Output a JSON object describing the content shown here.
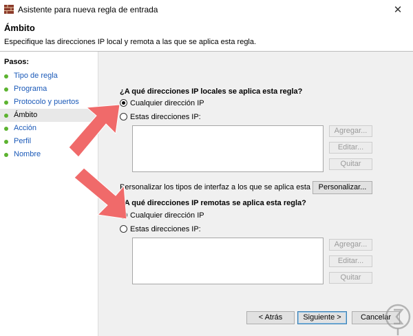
{
  "window": {
    "title": "Asistente para nueva regla de entrada",
    "close_icon": "close-icon"
  },
  "header": {
    "title": "Ámbito",
    "description": "Especifique las direcciones IP local y remota a las que se aplica esta regla."
  },
  "sidebar": {
    "steps_label": "Pasos:",
    "items": [
      {
        "label": "Tipo de regla",
        "active": false
      },
      {
        "label": "Programa",
        "active": false
      },
      {
        "label": "Protocolo y puertos",
        "active": false
      },
      {
        "label": "Ámbito",
        "active": true
      },
      {
        "label": "Acción",
        "active": false
      },
      {
        "label": "Perfil",
        "active": false
      },
      {
        "label": "Nombre",
        "active": false
      }
    ],
    "dot_color": "#5cb330"
  },
  "local": {
    "question": "¿A qué direcciones IP locales se aplica esta regla?",
    "option_any": "Cualquier dirección IP",
    "option_these": "Estas direcciones IP:",
    "selected": "any",
    "add_label": "Agregar...",
    "edit_label": "Editar...",
    "remove_label": "Quitar"
  },
  "interface": {
    "text": "Personalizar los tipos de interfaz a los que se aplica esta regla:",
    "button_label": "Personalizar..."
  },
  "remote": {
    "question": "¿A qué direcciones IP remotas se aplica esta regla?",
    "option_any": "Cualquier dirección IP",
    "option_these": "Estas direcciones IP:",
    "selected": "any",
    "add_label": "Agregar...",
    "edit_label": "Editar...",
    "remove_label": "Quitar"
  },
  "footer": {
    "back_label": "< Atrás",
    "next_label": "Siguiente >",
    "cancel_label": "Cancelar"
  },
  "colors": {
    "arrow": "#f06a6a",
    "link": "#1a59b8",
    "content_bg": "#f0f0f0"
  }
}
